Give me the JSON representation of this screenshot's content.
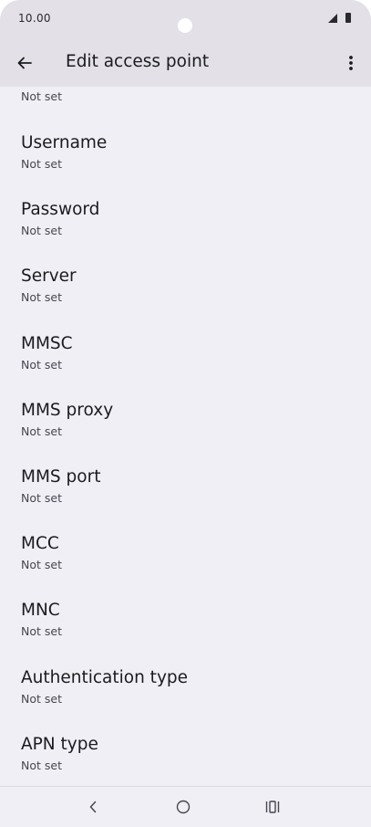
{
  "status_bar": {
    "time": "10.00"
  },
  "header": {
    "title": "Edit access point"
  },
  "partial_item": {
    "subtitle": "Not set"
  },
  "items": [
    {
      "title": "Username",
      "subtitle": "Not set"
    },
    {
      "title": "Password",
      "subtitle": "Not set"
    },
    {
      "title": "Server",
      "subtitle": "Not set"
    },
    {
      "title": "MMSC",
      "subtitle": "Not set"
    },
    {
      "title": "MMS proxy",
      "subtitle": "Not set"
    },
    {
      "title": "MMS port",
      "subtitle": "Not set"
    },
    {
      "title": "MCC",
      "subtitle": "Not set"
    },
    {
      "title": "MNC",
      "subtitle": "Not set"
    },
    {
      "title": "Authentication type",
      "subtitle": "Not set"
    },
    {
      "title": "APN type",
      "subtitle": "Not set"
    }
  ],
  "icons": {
    "back": "arrow-back-icon",
    "more": "more-vert-icon",
    "nav_back": "chevron-left-icon",
    "nav_home": "circle-home-icon",
    "nav_recents": "recents-icon"
  },
  "colors": {
    "background": "#f1eff6",
    "app_bar": "#e3e1e7",
    "text_primary": "#1b1b1f",
    "text_secondary": "#47464f"
  }
}
